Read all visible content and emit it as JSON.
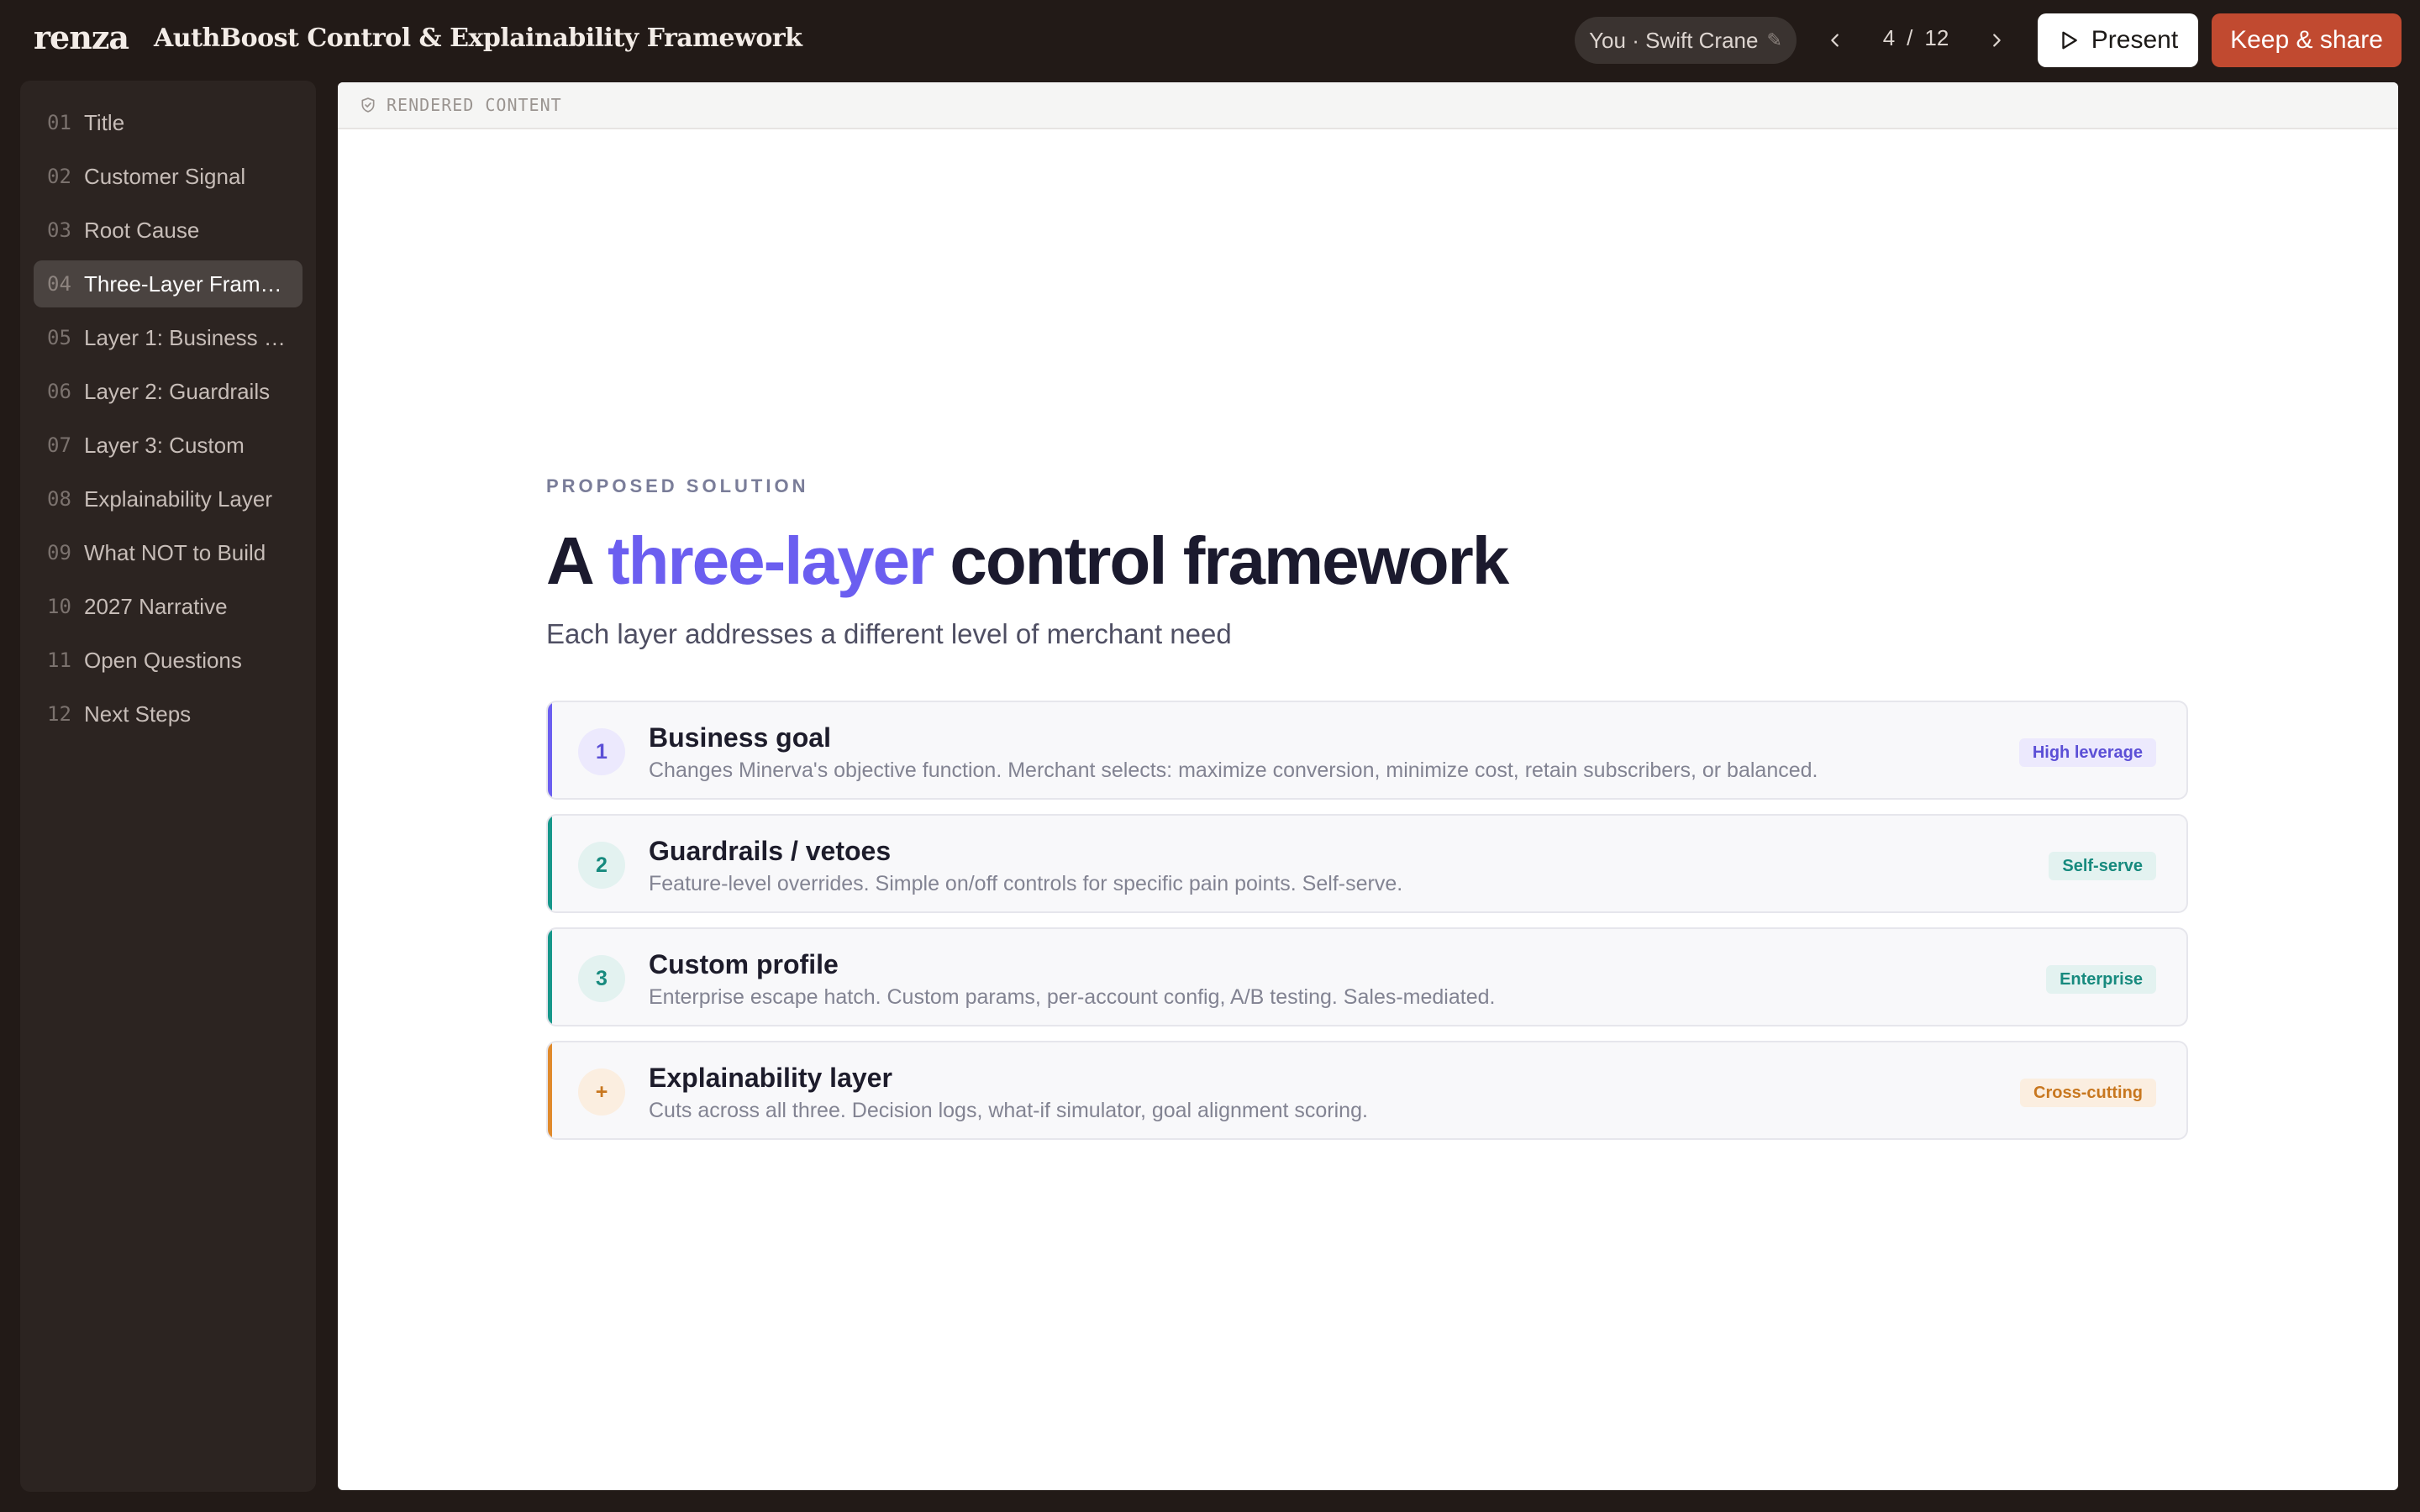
{
  "app": {
    "logo": "renza",
    "doc_title": "AuthBoost Control & Explainability Framework"
  },
  "topbar": {
    "user_label": "You · Swift Crane",
    "user_edit_icon": "✎",
    "page_current": "4",
    "page_sep": "/",
    "page_total": "12",
    "present_label": "Present",
    "keep_share_label": "Keep & share"
  },
  "sidebar": {
    "items": [
      {
        "num": "01",
        "label": "Title"
      },
      {
        "num": "02",
        "label": "Customer Signal"
      },
      {
        "num": "03",
        "label": "Root Cause"
      },
      {
        "num": "04",
        "label": "Three-Layer Framework",
        "active": true
      },
      {
        "num": "05",
        "label": "Layer 1: Business Goal"
      },
      {
        "num": "06",
        "label": "Layer 2: Guardrails"
      },
      {
        "num": "07",
        "label": "Layer 3: Custom"
      },
      {
        "num": "08",
        "label": "Explainability Layer"
      },
      {
        "num": "09",
        "label": "What NOT to Build"
      },
      {
        "num": "10",
        "label": "2027 Narrative"
      },
      {
        "num": "11",
        "label": "Open Questions"
      },
      {
        "num": "12",
        "label": "Next Steps"
      }
    ]
  },
  "canvas": {
    "header_label": "RENDERED CONTENT"
  },
  "slide": {
    "kicker": "PROPOSED SOLUTION",
    "headline_pre": "A ",
    "headline_accent": "three-layer",
    "headline_post": " control framework",
    "subhead": "Each layer addresses a different level of merchant need",
    "layers": [
      {
        "badge": "1",
        "name": "Business goal",
        "desc": "Changes Minerva's objective function. Merchant selects: maximize conversion, minimize cost, retain subscribers, or balanced.",
        "tag": "High leverage",
        "accent": "#6b5ef0",
        "badge_bg": "#ece9fd",
        "tag_bg": "#ece9fd",
        "tag_color": "#5b4fd6"
      },
      {
        "badge": "2",
        "name": "Guardrails / vetoes",
        "desc": "Feature-level overrides. Simple on/off controls for specific pain points. Self-serve.",
        "tag": "Self-serve",
        "accent": "#16978a",
        "badge_bg": "#e3f2f0",
        "tag_bg": "#e3f2f0",
        "tag_color": "#178a7e"
      },
      {
        "badge": "3",
        "name": "Custom profile",
        "desc": "Enterprise escape hatch. Custom params, per-account config, A/B testing. Sales-mediated.",
        "tag": "Enterprise",
        "accent": "#16978a",
        "badge_bg": "#e3f2f0",
        "tag_bg": "#e3f2f0",
        "tag_color": "#178a7e"
      },
      {
        "badge": "+",
        "name": "Explainability layer",
        "desc": "Cuts across all three. Decision logs, what-if simulator, goal alignment scoring.",
        "tag": "Cross-cutting",
        "accent": "#e08a2c",
        "badge_bg": "#fbeee0",
        "tag_bg": "#fbeee0",
        "tag_color": "#c8771f"
      }
    ]
  }
}
